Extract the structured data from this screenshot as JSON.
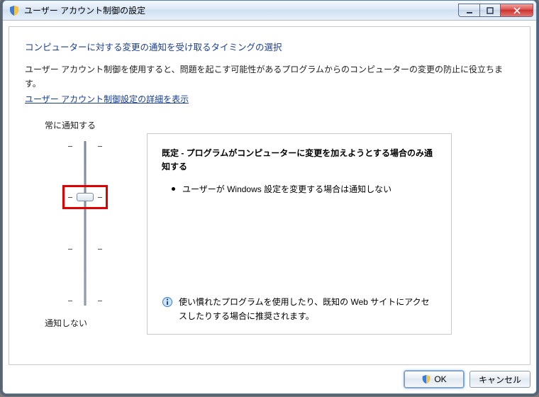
{
  "window": {
    "title": "ユーザー アカウント制御の設定"
  },
  "heading": "コンピューターに対する変更の通知を受け取るタイミングの選択",
  "description": "ユーザー アカウント制御を使用すると、問題を起こす可能性があるプログラムからのコンピューターの変更の防止に役立ちます。",
  "link_text": "ユーザー アカウント制御設定の詳細を表示",
  "slider": {
    "top_label": "常に通知する",
    "bottom_label": "通知しない",
    "levels": 4,
    "current_level": 2,
    "highlighted_level": 2
  },
  "panel": {
    "title": "既定 - プログラムがコンピューターに変更を加えようとする場合のみ通知する",
    "bullets": [
      "ユーザーが Windows 設定を変更する場合は通知しない"
    ],
    "recommendation": "使い慣れたプログラムを使用したり、既知の Web サイトにアクセスしたりする場合に推奨されます。"
  },
  "buttons": {
    "ok": "OK",
    "cancel": "キャンセル"
  },
  "colors": {
    "link": "#1a3e8b",
    "highlight": "#e10000"
  }
}
